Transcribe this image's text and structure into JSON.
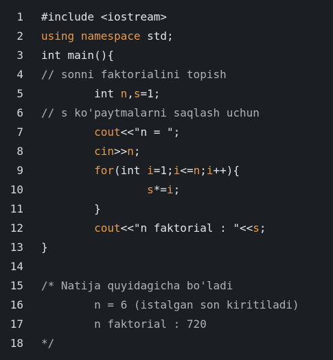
{
  "editor": {
    "lines": [
      {
        "n": "1",
        "tokens": [
          {
            "t": "#include <iostream>",
            "c": "plain"
          }
        ]
      },
      {
        "n": "2",
        "tokens": [
          {
            "t": "using",
            "c": "kw"
          },
          {
            "t": " ",
            "c": "plain"
          },
          {
            "t": "namespace",
            "c": "kw"
          },
          {
            "t": " std;",
            "c": "plain"
          }
        ]
      },
      {
        "n": "3",
        "tokens": [
          {
            "t": "int main(){",
            "c": "plain"
          }
        ]
      },
      {
        "n": "4",
        "tokens": [
          {
            "t": "// sonni faktorialini topish",
            "c": "cm"
          }
        ]
      },
      {
        "n": "5",
        "tokens": [
          {
            "t": "        int ",
            "c": "plain"
          },
          {
            "t": "n",
            "c": "vr"
          },
          {
            "t": ",",
            "c": "plain"
          },
          {
            "t": "s",
            "c": "vr"
          },
          {
            "t": "=1;",
            "c": "plain"
          }
        ]
      },
      {
        "n": "6",
        "tokens": [
          {
            "t": "// s ko'paytmalarni saqlash uchun",
            "c": "cm"
          }
        ]
      },
      {
        "n": "7",
        "tokens": [
          {
            "t": "        ",
            "c": "plain"
          },
          {
            "t": "cout",
            "c": "kw"
          },
          {
            "t": "<<\"n = \";",
            "c": "plain"
          }
        ]
      },
      {
        "n": "8",
        "tokens": [
          {
            "t": "        ",
            "c": "plain"
          },
          {
            "t": "cin",
            "c": "kw"
          },
          {
            "t": ">>",
            "c": "plain"
          },
          {
            "t": "n",
            "c": "vr"
          },
          {
            "t": ";",
            "c": "plain"
          }
        ]
      },
      {
        "n": "9",
        "tokens": [
          {
            "t": "        ",
            "c": "plain"
          },
          {
            "t": "for",
            "c": "kw"
          },
          {
            "t": "(int ",
            "c": "plain"
          },
          {
            "t": "i",
            "c": "vr"
          },
          {
            "t": "=1;",
            "c": "plain"
          },
          {
            "t": "i",
            "c": "vr"
          },
          {
            "t": "<=",
            "c": "plain"
          },
          {
            "t": "n",
            "c": "vr"
          },
          {
            "t": ";",
            "c": "plain"
          },
          {
            "t": "i",
            "c": "vr"
          },
          {
            "t": "++){",
            "c": "plain"
          }
        ]
      },
      {
        "n": "10",
        "tokens": [
          {
            "t": "                ",
            "c": "plain"
          },
          {
            "t": "s",
            "c": "vr"
          },
          {
            "t": "*=",
            "c": "plain"
          },
          {
            "t": "i",
            "c": "vr"
          },
          {
            "t": ";",
            "c": "plain"
          }
        ]
      },
      {
        "n": "11",
        "tokens": [
          {
            "t": "        }",
            "c": "plain"
          }
        ]
      },
      {
        "n": "12",
        "tokens": [
          {
            "t": "        ",
            "c": "plain"
          },
          {
            "t": "cout",
            "c": "kw"
          },
          {
            "t": "<<\"n faktorial : \"<<",
            "c": "plain"
          },
          {
            "t": "s",
            "c": "vr"
          },
          {
            "t": ";",
            "c": "plain"
          }
        ]
      },
      {
        "n": "13",
        "tokens": [
          {
            "t": "}",
            "c": "plain"
          }
        ]
      },
      {
        "n": "14",
        "tokens": []
      },
      {
        "n": "15",
        "tokens": [
          {
            "t": "/* Natija quyidagicha bo'ladi",
            "c": "cm"
          }
        ]
      },
      {
        "n": "16",
        "tokens": [
          {
            "t": "        n = 6 (istalgan son kiritiladi)",
            "c": "cm"
          }
        ]
      },
      {
        "n": "17",
        "tokens": [
          {
            "t": "        n faktorial : 720",
            "c": "cm"
          }
        ]
      },
      {
        "n": "18",
        "tokens": [
          {
            "t": "*/",
            "c": "cm"
          }
        ]
      }
    ],
    "colors": {
      "background": "#1b1f23",
      "keyword": "#e89a4e",
      "comment": "#adb3ba",
      "text": "#e3e6e9",
      "line_number": "#d7dadd"
    }
  }
}
